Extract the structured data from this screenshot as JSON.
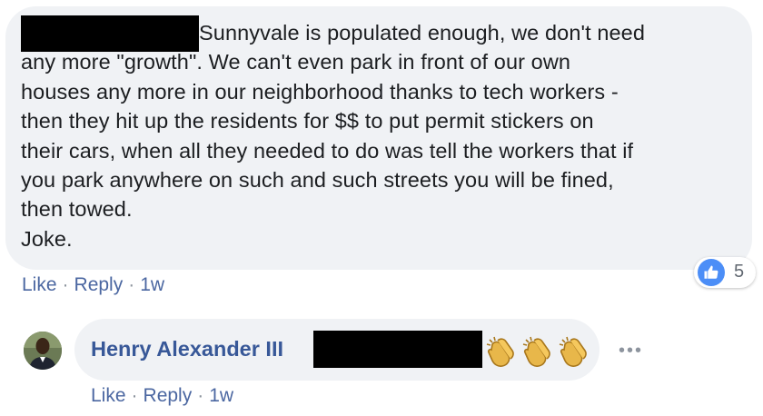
{
  "comment1": {
    "text": "Sunnyvale is populated enough, we don't need\nany more \"growth\". We can't even park in front of our own\nhouses any more in our neighborhood thanks to tech workers -\nthen they hit up the residents for $$ to put permit stickers on\ntheir cars, when all they needed to do was tell the workers that if\nyou park anywhere on such and such streets you will be fined,\nthen towed.\nJoke.",
    "like_label": "Like",
    "reply_label": "Reply",
    "time": "1w",
    "reaction_count": "5",
    "reaction_icon": "thumbs-up-icon",
    "like_color": "#4c8ef7"
  },
  "comment2": {
    "author": "Henry Alexander III",
    "emoji": [
      "clapping-hands-icon",
      "clapping-hands-icon",
      "clapping-hands-icon"
    ],
    "like_label": "Like",
    "reply_label": "Reply",
    "time": "1w",
    "more_icon": "more-options-icon"
  },
  "separator": "·",
  "colors": {
    "bubble": "#f0f2f5",
    "link": "#4b67a1",
    "author": "#385898"
  }
}
